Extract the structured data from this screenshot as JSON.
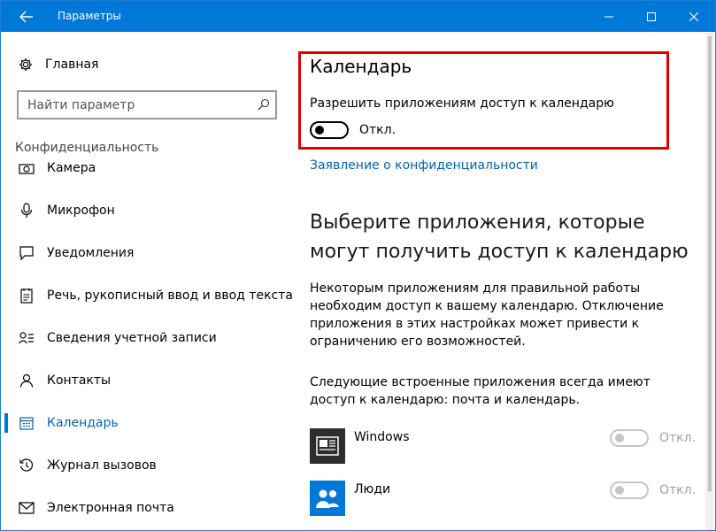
{
  "window": {
    "title": "Параметры"
  },
  "sidebar": {
    "home_label": "Главная",
    "search_placeholder": "Найти параметр",
    "section_title": "Конфиденциальность",
    "items": [
      {
        "label": "Камера",
        "icon": "camera-icon"
      },
      {
        "label": "Микрофон",
        "icon": "microphone-icon"
      },
      {
        "label": "Уведомления",
        "icon": "notifications-icon"
      },
      {
        "label": "Речь, рукописный ввод и ввод текста",
        "icon": "speech-icon"
      },
      {
        "label": "Сведения учетной записи",
        "icon": "account-info-icon"
      },
      {
        "label": "Контакты",
        "icon": "contacts-icon"
      },
      {
        "label": "Календарь",
        "icon": "calendar-icon",
        "active": true
      },
      {
        "label": "Журнал вызовов",
        "icon": "call-history-icon"
      },
      {
        "label": "Электронная почта",
        "icon": "email-icon"
      }
    ]
  },
  "main": {
    "title": "Календарь",
    "permission_label": "Разрешить приложениям доступ к календарю",
    "toggle_state": "Откл.",
    "privacy_link": "Заявление о конфиденциальности",
    "apps_heading": "Выберите приложения, которые могут получить доступ к календарю",
    "apps_description": "Некоторым приложениям для правильной работы необходим доступ к вашему календарю. Отключение приложения в этих настройках может привести к ограничению его возможностей.",
    "builtin_note": "Следующие встроенные приложения всегда имеют доступ к календарю: почта и календарь.",
    "apps": [
      {
        "name": "Windows",
        "state": "Откл.",
        "icon": "windows-app-icon",
        "color": "#2d2d2d"
      },
      {
        "name": "Люди",
        "state": "Откл.",
        "icon": "people-app-icon",
        "color": "#0078d7"
      }
    ]
  },
  "colors": {
    "accent": "#0078d7",
    "highlight_border": "#e00000",
    "link": "#0063b1"
  }
}
